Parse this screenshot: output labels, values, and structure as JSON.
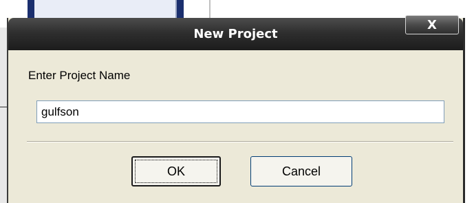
{
  "dialog": {
    "title": "New Project",
    "close_label": "X",
    "prompt": "Enter Project Name",
    "project_name": "gulfson",
    "ok_label": "OK",
    "cancel_label": "Cancel"
  },
  "colors": {
    "titlebar": "#2f2f2f",
    "dialog_bg": "#ece9d8",
    "input_border": "#7f9db9"
  }
}
